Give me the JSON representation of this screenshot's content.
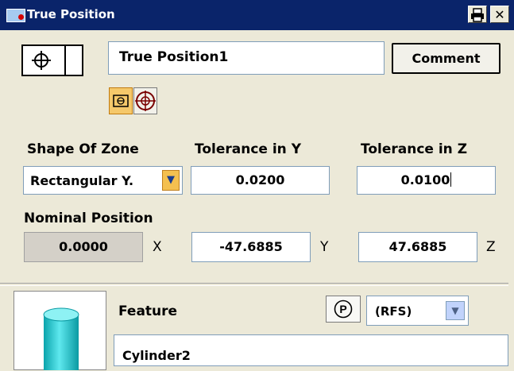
{
  "window": {
    "title": "True Position"
  },
  "header": {
    "name_value": "True Position1",
    "comment_label": "Comment"
  },
  "labels": {
    "shape_of_zone": "Shape Of Zone",
    "tolerance_y": "Tolerance in Y",
    "tolerance_z": "Tolerance in Z",
    "nominal_position": "Nominal Position",
    "x_axis": "X",
    "y_axis": "Y",
    "z_axis": "Z",
    "feature": "Feature"
  },
  "values": {
    "shape_of_zone": "Rectangular Y.",
    "tolerance_y": "0.0200",
    "tolerance_z": "0.0100",
    "nominal_x": "0.0000",
    "nominal_y": "-47.6885",
    "nominal_z": "47.6885",
    "material_condition": "(RFS)",
    "feature_name": "Cylinder2"
  },
  "icons": {
    "app": "app-window-icon",
    "print": "print-icon",
    "close": "close-icon",
    "true_position": "true-position-symbol-icon",
    "zone_rectangular": "rectangular-zone-icon",
    "zone_circular": "circular-zone-icon",
    "projected": "projected-tolerance-icon",
    "cylinder": "cylinder-icon",
    "dropdown": "chevron-down-icon"
  },
  "colors": {
    "title_bar": "#0a246a",
    "dialog": "#ece9d8",
    "dropdown_accent": "#f4c050",
    "selected_button": "#f5c86a",
    "cylinder": "#2ac4cc"
  }
}
